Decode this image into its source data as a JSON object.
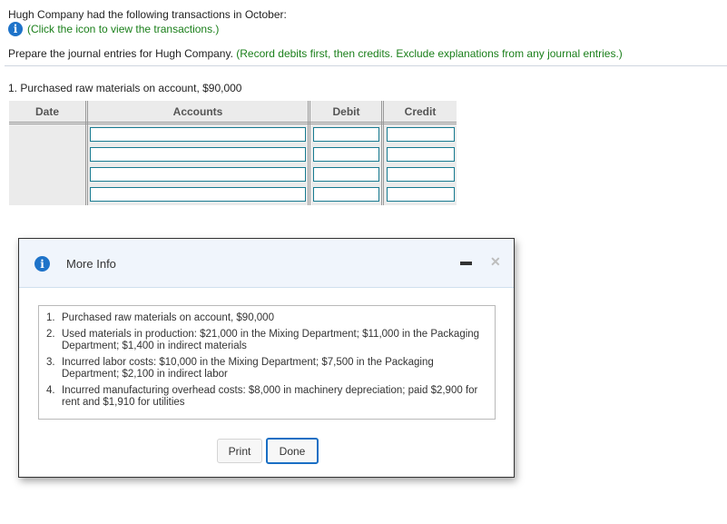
{
  "intro": {
    "text": "Hugh Company had the following transactions in October:",
    "hint_icon": "info-icon",
    "hint_text": "(Click the icon to view the transactions.)"
  },
  "instructions": {
    "text": "Prepare the journal entries for Hugh Company.",
    "note": "(Record debits first, then credits. Exclude explanations from any journal entries.)"
  },
  "transaction": {
    "title": "1. Purchased raw materials on account, $90,000"
  },
  "journal_table": {
    "columns": [
      "Date",
      "Accounts",
      "Debit",
      "Credit"
    ],
    "rows": [
      {
        "account": "",
        "debit": "",
        "credit": ""
      },
      {
        "account": "",
        "debit": "",
        "credit": ""
      },
      {
        "account": "",
        "debit": "",
        "credit": ""
      },
      {
        "account": "",
        "debit": "",
        "credit": ""
      }
    ]
  },
  "modal": {
    "icon": "info-icon",
    "title": "More Info",
    "minimize_icon": "minimize-icon",
    "close_icon": "close-icon",
    "items": [
      {
        "num": "1.",
        "text": "Purchased raw materials on account, $90,000"
      },
      {
        "num": "2.",
        "text": "Used materials in production: $21,000 in the Mixing Department; $11,000 in the Packaging Department; $1,400 in indirect materials"
      },
      {
        "num": "3.",
        "text": "Incurred labor costs: $10,000 in the Mixing Department; $7,500 in the Packaging Department; $2,100 in indirect labor"
      },
      {
        "num": "4.",
        "text": "Incurred manufacturing overhead costs: $8,000 in machinery depreciation; paid $2,900 for rent and $1,910 for utilities"
      }
    ],
    "print_label": "Print",
    "done_label": "Done"
  },
  "colors": {
    "accent_green": "#1a7f1a",
    "info_blue": "#1e73c9",
    "input_border": "#177a90",
    "done_border": "#1a6fc4"
  }
}
